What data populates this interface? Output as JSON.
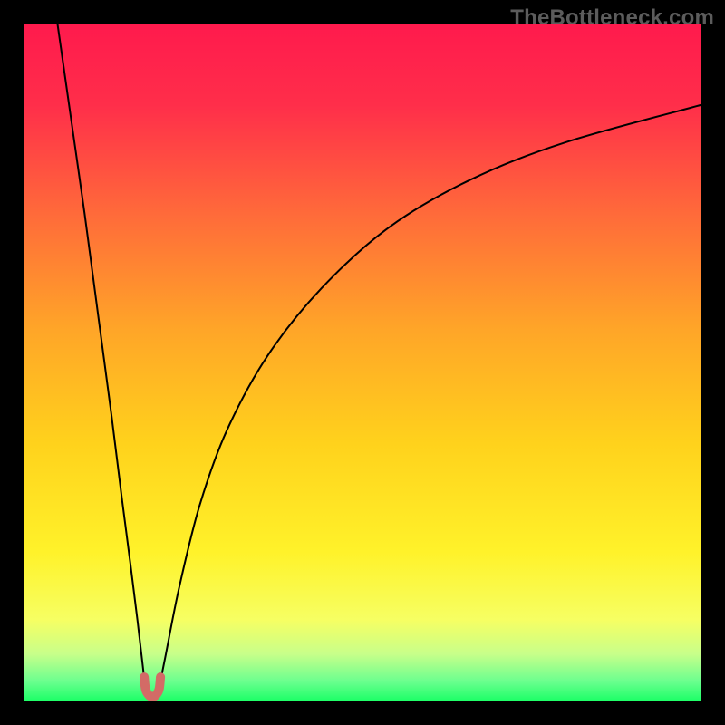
{
  "watermark": "TheBottleneck.com",
  "chart_data": {
    "type": "line",
    "title": "",
    "xlabel": "",
    "ylabel": "",
    "xlim": [
      0,
      100
    ],
    "ylim": [
      0,
      100
    ],
    "background": {
      "type": "vertical_gradient",
      "stops": [
        {
          "pos": 0.0,
          "color": "#ff1a4d"
        },
        {
          "pos": 0.12,
          "color": "#ff2e4a"
        },
        {
          "pos": 0.28,
          "color": "#ff6a3a"
        },
        {
          "pos": 0.45,
          "color": "#ffa528"
        },
        {
          "pos": 0.62,
          "color": "#ffd21c"
        },
        {
          "pos": 0.78,
          "color": "#fff22a"
        },
        {
          "pos": 0.88,
          "color": "#f6ff63"
        },
        {
          "pos": 0.93,
          "color": "#c8ff8a"
        },
        {
          "pos": 0.97,
          "color": "#6cff8f"
        },
        {
          "pos": 1.0,
          "color": "#1aff66"
        }
      ]
    },
    "border": {
      "width": 26,
      "color": "#000000"
    },
    "series": [
      {
        "name": "bottleneck_curve_left",
        "color": "#000000",
        "width": 2,
        "x": [
          5.0,
          7.0,
          9.0,
          11.0,
          13.0,
          14.5,
          15.8,
          16.8,
          17.5,
          17.9
        ],
        "y": [
          100.0,
          86.0,
          72.0,
          57.0,
          42.0,
          30.0,
          20.0,
          12.0,
          6.0,
          2.5
        ]
      },
      {
        "name": "bottleneck_curve_right",
        "color": "#000000",
        "width": 2,
        "x": [
          20.1,
          21.0,
          23.0,
          26.0,
          30.0,
          36.0,
          44.0,
          54.0,
          66.0,
          80.0,
          100.0
        ],
        "y": [
          2.5,
          7.0,
          17.0,
          29.0,
          40.0,
          51.0,
          61.0,
          70.0,
          77.0,
          82.5,
          88.0
        ]
      },
      {
        "name": "optimal_marker",
        "type": "marker_u",
        "color": "#d36b66",
        "width": 10,
        "x": [
          17.8,
          18.0,
          18.5,
          19.0,
          19.5,
          20.0,
          20.2
        ],
        "y": [
          3.6,
          1.8,
          0.9,
          0.7,
          0.9,
          1.8,
          3.6
        ]
      }
    ]
  }
}
